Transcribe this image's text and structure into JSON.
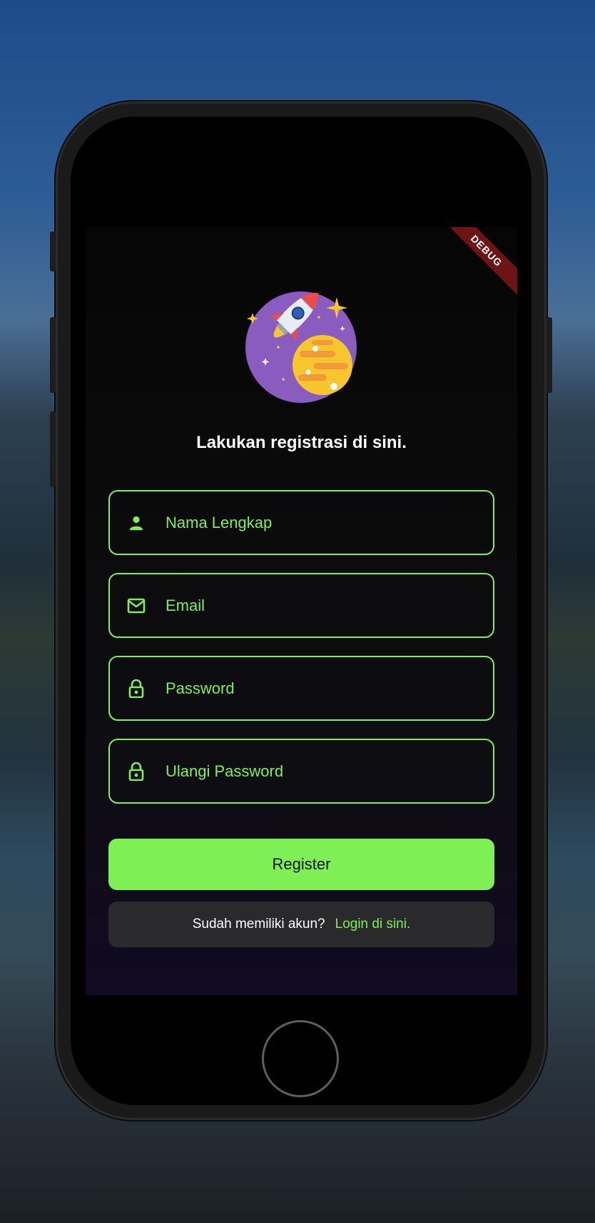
{
  "debug_banner": "DEBUG",
  "title": "Lakukan registrasi di sini.",
  "fields": [
    {
      "placeholder": "Nama Lengkap",
      "icon": "person-icon"
    },
    {
      "placeholder": "Email",
      "icon": "mail-icon"
    },
    {
      "placeholder": "Password",
      "icon": "lock-icon"
    },
    {
      "placeholder": "Ulangi Password",
      "icon": "lock-icon"
    }
  ],
  "register_label": "Register",
  "login_prompt": "Sudah memiliki akun?",
  "login_link": "Login di sini.",
  "colors": {
    "accent": "#7ef055",
    "background": "#0b0b0c",
    "debug": "#6e1414",
    "login_box": "#2a2a2c"
  }
}
